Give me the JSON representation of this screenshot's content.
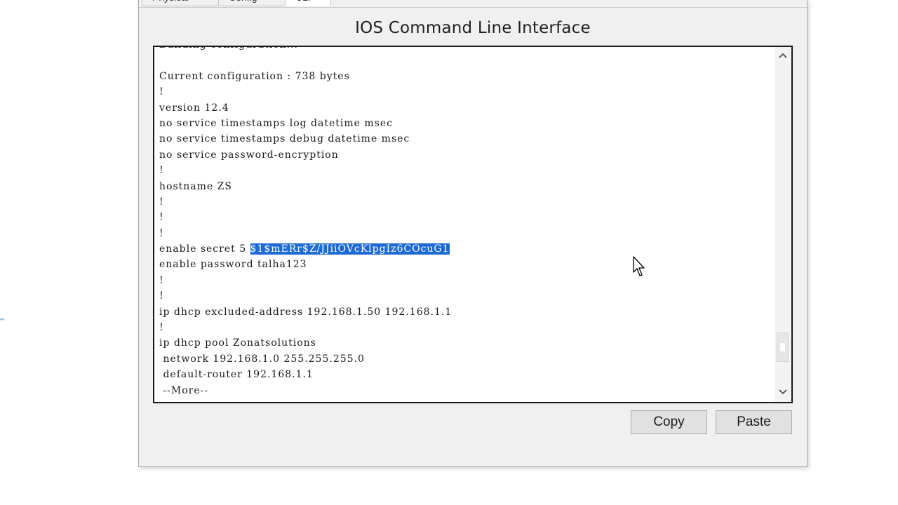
{
  "window": {
    "tabs": [
      {
        "label": "Physical"
      },
      {
        "label": "Config"
      },
      {
        "label": "CLI"
      }
    ],
    "title": "IOS Command Line Interface"
  },
  "terminal": {
    "lines": [
      {
        "text": "Building configuration..."
      },
      {
        "text": ""
      },
      {
        "text": "Current configuration : 738 bytes"
      },
      {
        "text": "!"
      },
      {
        "text": "version 12.4"
      },
      {
        "text": "no service timestamps log datetime msec"
      },
      {
        "text": "no service timestamps debug datetime msec"
      },
      {
        "text": "no service password-encryption"
      },
      {
        "text": "!"
      },
      {
        "text": "hostname ZS"
      },
      {
        "text": "!"
      },
      {
        "text": "!"
      },
      {
        "text": "!"
      },
      {
        "prefix": "enable secret 5 ",
        "selected": "$1$mERr$Z/JJiiOVcKlpgIz6COcuG1"
      },
      {
        "text": "enable password talha123"
      },
      {
        "text": "!"
      },
      {
        "text": "!"
      },
      {
        "text": "ip dhcp excluded-address 192.168.1.50 192.168.1.1"
      },
      {
        "text": "!"
      },
      {
        "text": "ip dhcp pool Zonatsolutions"
      },
      {
        "text": " network 192.168.1.0 255.255.255.0"
      },
      {
        "text": " default-router 192.168.1.1"
      },
      {
        "text": " --More--"
      }
    ],
    "selection_color": "#1d6ad4"
  },
  "scrollbar": {
    "up_icon": "chevron-up-icon",
    "down_icon": "chevron-down-icon",
    "position": 0.92
  },
  "buttons": {
    "copy_label": "Copy",
    "paste_label": "Paste"
  }
}
